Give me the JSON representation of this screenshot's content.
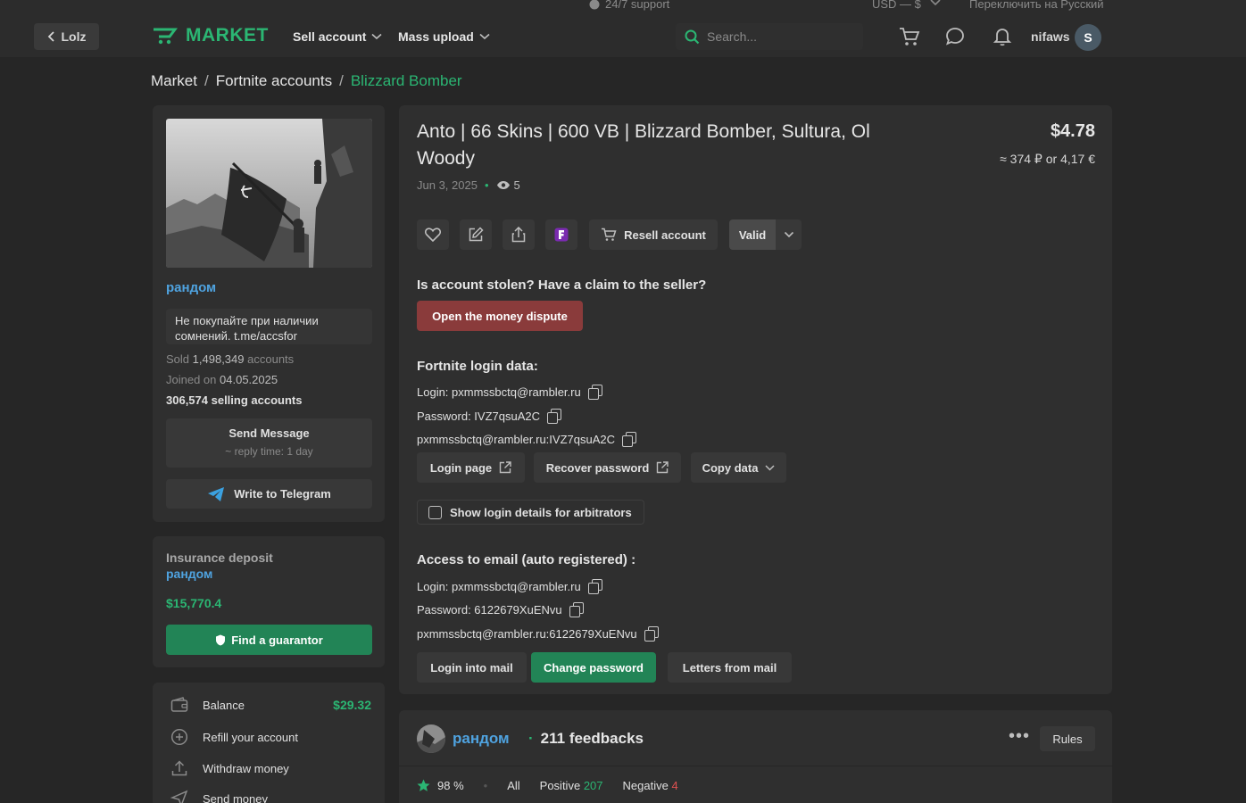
{
  "topbar": {
    "support": "24/7 support",
    "currency": "USD — $",
    "language_switch": "Переключить на Русский"
  },
  "header": {
    "back_label": "Lolz",
    "logo_text": "MARKET",
    "nav": [
      {
        "label": "Sell account"
      },
      {
        "label": "Mass upload"
      }
    ],
    "search_placeholder": "Search...",
    "username": "nifaws",
    "avatar_letter": "S"
  },
  "breadcrumb": {
    "items": [
      "Market",
      "Fortnite accounts",
      "Blizzard Bomber"
    ],
    "separator": "/"
  },
  "seller": {
    "name": "рандом",
    "note": "Не покупайте при наличии сомнений. t.me/accsfor",
    "sold_prefix": "Sold",
    "sold_count": "1,498,349",
    "sold_suffix": "accounts",
    "joined_prefix": "Joined on",
    "joined_date": "04.05.2025",
    "selling": "306,574 selling accounts",
    "send_message": "Send Message",
    "reply_time": "~ reply time: 1 day",
    "telegram": "Write to Telegram"
  },
  "deposit": {
    "title": "Insurance deposit",
    "name": "рандом",
    "amount": "$15,770.4",
    "guarantor_btn": "Find a guarantor"
  },
  "balance_menu": {
    "items": [
      {
        "label": "Balance",
        "amount": "$29.32"
      },
      {
        "label": "Refill your account"
      },
      {
        "label": "Withdraw money"
      },
      {
        "label": "Send money"
      }
    ]
  },
  "listing": {
    "title": "Anto | 66 Skins | 600 VB | Blizzard Bomber, Sultura, Ol Woody",
    "price": "$4.78",
    "price_converted": "≈ 374 ₽ or 4,17 €",
    "date": "Jun 3, 2025",
    "views": "5",
    "resell_label": "Resell account",
    "status_label": "Valid",
    "claim_heading": "Is account stolen? Have a claim to the seller?",
    "dispute_btn": "Open the money dispute",
    "login_heading": "Fortnite login data:",
    "login_line": "Login: pxmmssbctq@rambler.ru",
    "password_line": "Password: IVZ7qsuA2C",
    "combo_line": "pxmmssbctq@rambler.ru:IVZ7qsuA2C",
    "login_page_btn": "Login page",
    "recover_btn": "Recover password",
    "copy_data_btn": "Copy data",
    "arbitrators_label": "Show login details for arbitrators",
    "email_heading": "Access to email (auto registered) :",
    "email_login_line": "Login: pxmmssbctq@rambler.ru",
    "email_password_line": "Password: 6122679XuENvu",
    "email_combo_line": "pxmmssbctq@rambler.ru:6122679XuENvu",
    "login_mail_btn": "Login into mail",
    "change_password_btn": "Change password",
    "letters_btn": "Letters from mail"
  },
  "feedback": {
    "name": "рандом",
    "count": "211 feedbacks",
    "rules_btn": "Rules",
    "rating": "98 %",
    "all_label": "All",
    "positive_label": "Positive",
    "positive_count": "207",
    "negative_label": "Negative",
    "negative_count": "4"
  },
  "colors": {
    "accent_green": "#2bb673",
    "link_blue": "#4fa3e0",
    "danger": "#8a3b3b",
    "panel": "#2f2f2f",
    "background": "#262626"
  }
}
